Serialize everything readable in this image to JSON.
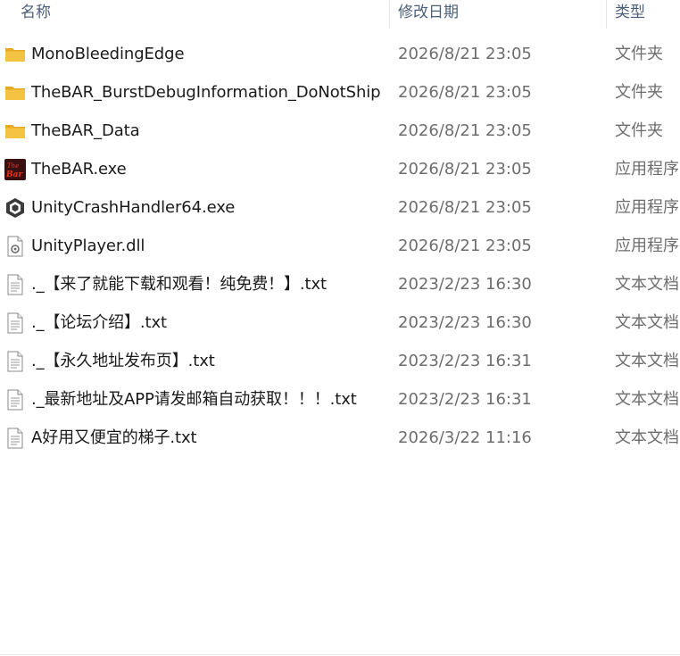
{
  "columns": {
    "name": "名称",
    "date_modified": "修改日期",
    "type": "类型"
  },
  "files": [
    {
      "name": "MonoBleedingEdge",
      "date": "2026/8/21 23:05",
      "type": "文件夹",
      "icon": "folder-icon"
    },
    {
      "name": "TheBAR_BurstDebugInformation_DoNotShip",
      "date": "2026/8/21 23:05",
      "type": "文件夹",
      "icon": "folder-icon"
    },
    {
      "name": "TheBAR_Data",
      "date": "2026/8/21 23:05",
      "type": "文件夹",
      "icon": "folder-icon"
    },
    {
      "name": "TheBAR.exe",
      "date": "2026/8/21 23:05",
      "type": "应用程序",
      "icon": "app-icon"
    },
    {
      "name": "UnityCrashHandler64.exe",
      "date": "2026/8/21 23:05",
      "type": "应用程序",
      "icon": "unity-icon"
    },
    {
      "name": "UnityPlayer.dll",
      "date": "2026/8/21 23:05",
      "type": "应用程序扩展",
      "icon": "dll-icon"
    },
    {
      "name": "._【来了就能下载和观看！纯免费！】.txt",
      "date": "2023/2/23 16:30",
      "type": "文本文档",
      "icon": "text-file-icon"
    },
    {
      "name": "._【论坛介绍】.txt",
      "date": "2023/2/23 16:30",
      "type": "文本文档",
      "icon": "text-file-icon"
    },
    {
      "name": "._【永久地址发布页】.txt",
      "date": "2023/2/23 16:31",
      "type": "文本文档",
      "icon": "text-file-icon"
    },
    {
      "name": "._最新地址及APP请发邮箱自动获取！！！.txt",
      "date": "2023/2/23 16:31",
      "type": "文本文档",
      "icon": "text-file-icon"
    },
    {
      "name": "A好用又便宜的梯子.txt",
      "date": "2026/3/22 11:16",
      "type": "文本文档",
      "icon": "text-file-icon"
    }
  ],
  "colors": {
    "header_text": "#4c607a",
    "folder_yellow": "#f5c342",
    "folder_back": "#e6a923",
    "app_icon_bg": "#3a0f10",
    "app_icon_text": "#e8361e"
  }
}
